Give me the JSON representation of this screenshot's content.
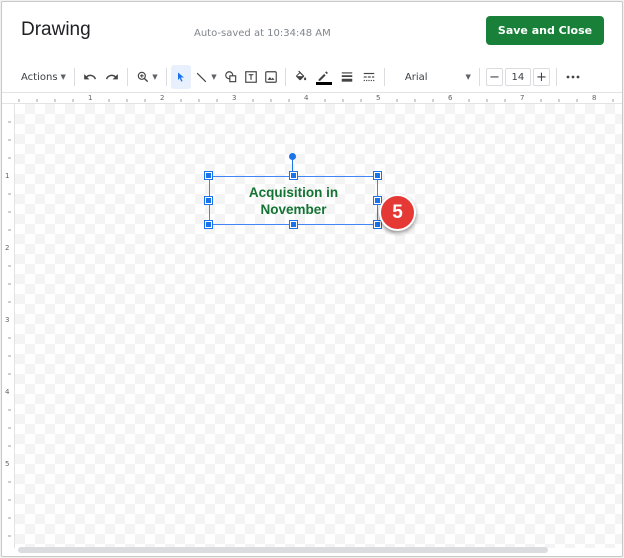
{
  "header": {
    "title": "Drawing",
    "autosave": "Auto-saved at 10:34:48 AM",
    "save_close_label": "Save and Close"
  },
  "toolbar": {
    "actions_label": "Actions",
    "font_name": "Arial",
    "font_size": "14",
    "minus": "−",
    "plus": "+"
  },
  "ruler": {
    "top_numbers": [
      "1",
      "2",
      "3",
      "4",
      "5",
      "6",
      "7",
      "8"
    ],
    "left_numbers": [
      "1",
      "2",
      "3",
      "4",
      "5"
    ]
  },
  "canvas": {
    "textbox_text": "Acquisition in November",
    "textbox_color": "#137333",
    "step_badge": "5",
    "badge_color": "#e53935"
  },
  "colors": {
    "accent": "#188038",
    "selection": "#1a73e8"
  }
}
